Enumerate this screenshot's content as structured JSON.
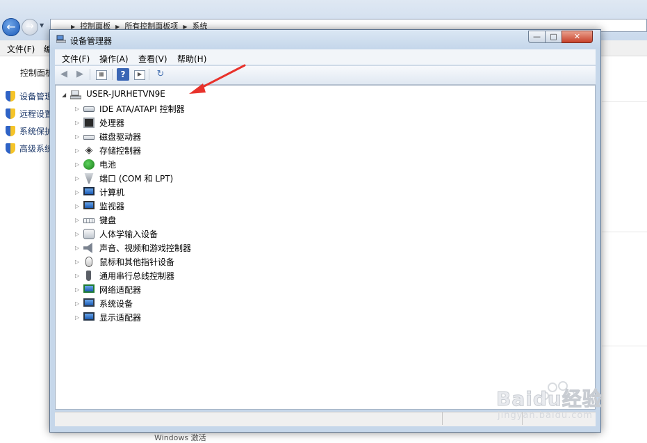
{
  "background_window": {
    "breadcrumb": [
      "控制面板",
      "所有控制面板项",
      "系统"
    ],
    "menu": {
      "file": "文件(F)",
      "edit_partial": "编"
    },
    "left_pane": {
      "home_link": "控制面板",
      "tasks": [
        "设备管理",
        "远程设置",
        "系统保护",
        "高级系统"
      ]
    },
    "bottom_text": "Windows 激活"
  },
  "device_manager": {
    "title": "设备管理器",
    "menu": [
      "文件(F)",
      "操作(A)",
      "查看(V)",
      "帮助(H)"
    ],
    "toolbar": [
      "back-icon",
      "forward-icon",
      "properties-icon",
      "help-icon",
      "list-view-icon",
      "scan-hardware-icon"
    ],
    "tree": {
      "root": "USER-JURHETVN9E",
      "categories": [
        {
          "label": "IDE ATA/ATAPI 控制器",
          "icon": "ide-controller-icon"
        },
        {
          "label": "处理器",
          "icon": "processor-icon"
        },
        {
          "label": "磁盘驱动器",
          "icon": "disk-drive-icon"
        },
        {
          "label": "存储控制器",
          "icon": "storage-controller-icon"
        },
        {
          "label": "电池",
          "icon": "battery-icon"
        },
        {
          "label": "端口 (COM 和 LPT)",
          "icon": "port-icon"
        },
        {
          "label": "计算机",
          "icon": "computer-icon"
        },
        {
          "label": "监视器",
          "icon": "monitor-icon"
        },
        {
          "label": "键盘",
          "icon": "keyboard-icon"
        },
        {
          "label": "人体学输入设备",
          "icon": "hid-icon"
        },
        {
          "label": "声音、视频和游戏控制器",
          "icon": "sound-icon"
        },
        {
          "label": "鼠标和其他指针设备",
          "icon": "mouse-icon"
        },
        {
          "label": "通用串行总线控制器",
          "icon": "usb-icon"
        },
        {
          "label": "网络适配器",
          "icon": "network-adapter-icon"
        },
        {
          "label": "系统设备",
          "icon": "system-device-icon"
        },
        {
          "label": "显示适配器",
          "icon": "display-adapter-icon"
        }
      ]
    }
  },
  "watermark": {
    "text": "Baidu经验",
    "sub": "jingyan.baidu.com"
  },
  "colors": {
    "annotation_arrow": "#e8322b",
    "titlebar": "#c4d6ea",
    "accent": "#1b59b8"
  }
}
